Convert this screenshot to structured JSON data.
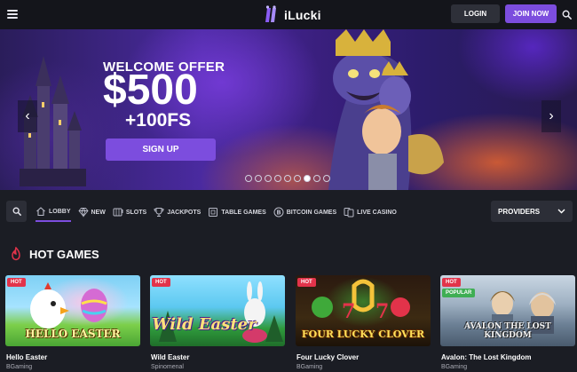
{
  "header": {
    "brand": "iLucki",
    "login_label": "LOGIN",
    "join_label": "JOIN NOW"
  },
  "hero": {
    "offer_title": "WELCOME OFFER",
    "offer_amount": "$500",
    "offer_freespins": "+100FS",
    "signup_label": "SIGN UP",
    "slide_count": 9,
    "active_slide": 6
  },
  "nav": {
    "tabs": [
      {
        "label": "LOBBY",
        "icon": "home-icon",
        "active": true
      },
      {
        "label": "NEW",
        "icon": "diamond-icon",
        "active": false
      },
      {
        "label": "SLOTS",
        "icon": "slots-icon",
        "active": false
      },
      {
        "label": "JACKPOTS",
        "icon": "trophy-icon",
        "active": false
      },
      {
        "label": "TABLE GAMES",
        "icon": "cards-icon",
        "active": false
      },
      {
        "label": "BITCOIN GAMES",
        "icon": "bitcoin-icon",
        "active": false
      },
      {
        "label": "LIVE CASINO",
        "icon": "live-cards-icon",
        "active": false
      }
    ],
    "providers_label": "PROVIDERS"
  },
  "section": {
    "title": "HOT GAMES"
  },
  "games": [
    {
      "name": "Hello Easter",
      "provider": "BGaming",
      "badges": [
        "HOT"
      ],
      "art_title": "HELLO EASTER"
    },
    {
      "name": "Wild Easter",
      "provider": "Spinomenal",
      "badges": [
        "HOT"
      ],
      "art_title": "Wild Easter"
    },
    {
      "name": "Four Lucky Clover",
      "provider": "BGaming",
      "badges": [
        "HOT"
      ],
      "art_title": "FOUR LUCKY CLOVER"
    },
    {
      "name": "Avalon: The Lost Kingdom",
      "provider": "BGaming",
      "badges": [
        "HOT",
        "POPULAR"
      ],
      "art_title": "AVALON THE LOST KINGDOM"
    }
  ],
  "colors": {
    "accent": "#7c4dde",
    "hot_badge": "#e2334a",
    "popular_badge": "#3fae54",
    "background": "#1b1d24",
    "topbar": "#14151b"
  }
}
